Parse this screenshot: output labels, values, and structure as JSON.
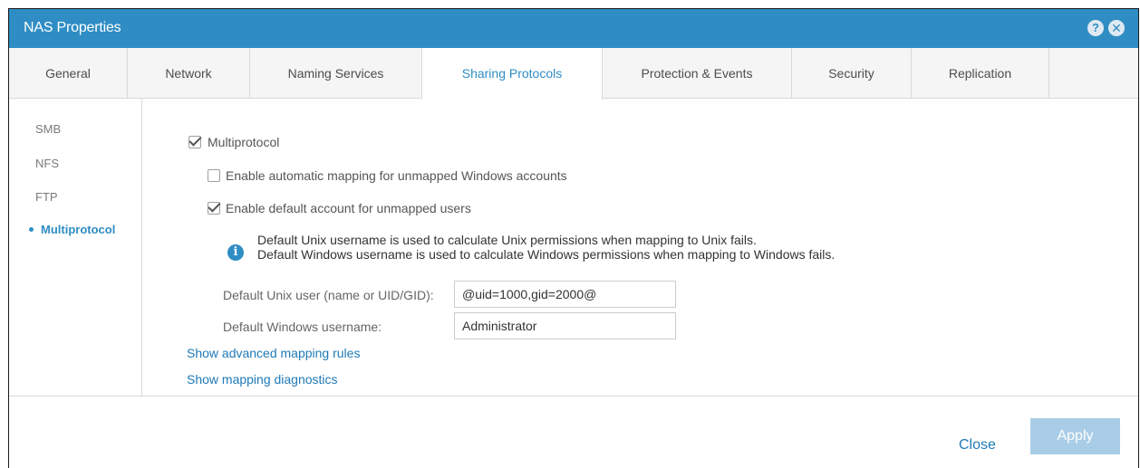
{
  "window": {
    "title": "NAS Properties",
    "help_glyph": "?",
    "close_glyph": "✕"
  },
  "tabs": [
    {
      "label": "General"
    },
    {
      "label": "Network"
    },
    {
      "label": "Naming Services"
    },
    {
      "label": "Sharing Protocols",
      "active": true
    },
    {
      "label": "Protection & Events"
    },
    {
      "label": "Security"
    },
    {
      "label": "Replication"
    }
  ],
  "sidebar": {
    "items": [
      {
        "label": "SMB"
      },
      {
        "label": "NFS"
      },
      {
        "label": "FTP"
      },
      {
        "label": "Multiprotocol",
        "active": true
      }
    ]
  },
  "multiprotocol": {
    "checkbox_label": "Multiprotocol",
    "checked": true,
    "auto_mapping_label": "Enable automatic mapping for unmapped Windows accounts",
    "auto_mapping_checked": false,
    "default_account_label": "Enable default account for unmapped users",
    "default_account_checked": true,
    "info_line1": "Default Unix username is used to calculate Unix permissions when mapping to Unix fails.",
    "info_line2": "Default Windows username is used to calculate Windows permissions when mapping to Windows fails.",
    "unix_user_label": "Default Unix user (name or UID/GID):",
    "unix_user_value": "@uid=1000,gid=2000@",
    "windows_user_label": "Default Windows username:",
    "windows_user_value": "Administrator",
    "advanced_link": "Show advanced mapping rules",
    "diagnostics_link": "Show mapping diagnostics"
  },
  "footer": {
    "close_label": "Close",
    "apply_label": "Apply",
    "apply_enabled": false
  },
  "colors": {
    "accent": "#2f8dc4",
    "link": "#1f7ab7",
    "apply_disabled": "#a9cde6"
  }
}
